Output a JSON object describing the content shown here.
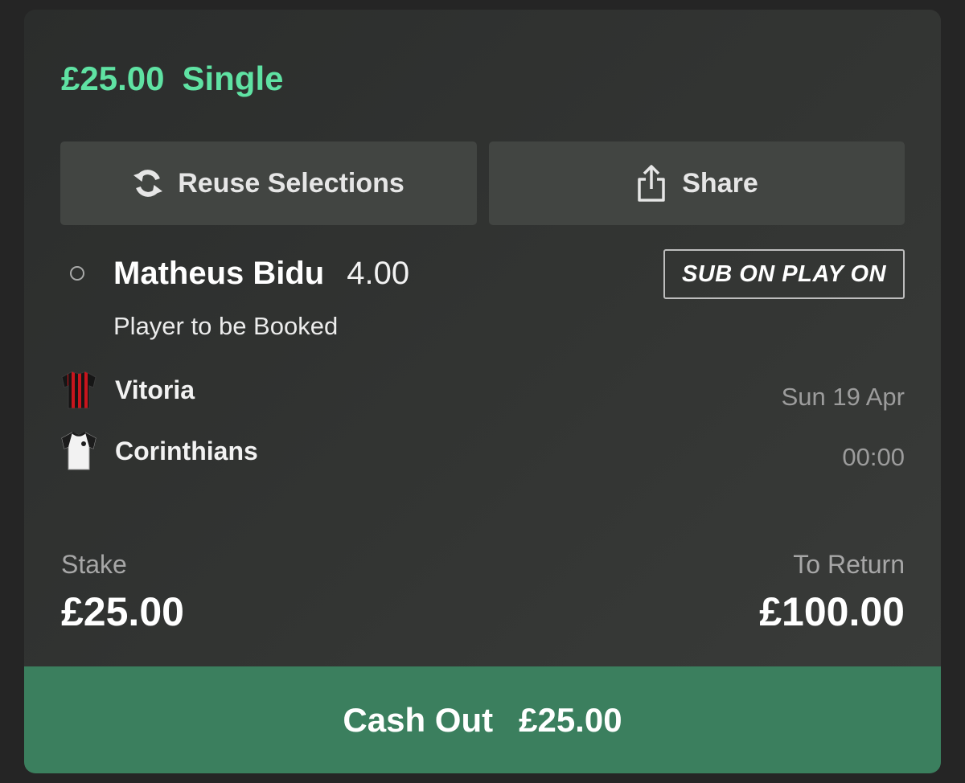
{
  "bet": {
    "stake_display": "£25.00",
    "type": "Single"
  },
  "actions": {
    "reuse_label": "Reuse Selections",
    "share_label": "Share",
    "reuse_icon": "refresh-icon",
    "share_icon": "share-icon"
  },
  "selection": {
    "name": "Matheus Bidu",
    "odds": "4.00",
    "badge": "SUB ON PLAY ON",
    "market": "Player to be Booked"
  },
  "event": {
    "home_team": "Vitoria",
    "away_team": "Corinthians",
    "date": "Sun 19 Apr",
    "time": "00:00"
  },
  "summary": {
    "stake_label": "Stake",
    "stake_value": "£25.00",
    "return_label": "To Return",
    "return_value": "£100.00"
  },
  "cashout": {
    "label": "Cash Out",
    "amount": "£25.00"
  },
  "colors": {
    "accent_green": "#5fe2a3",
    "cashout_green": "#3b7f5e",
    "card_bg": "#303230",
    "button_bg": "#424542"
  }
}
